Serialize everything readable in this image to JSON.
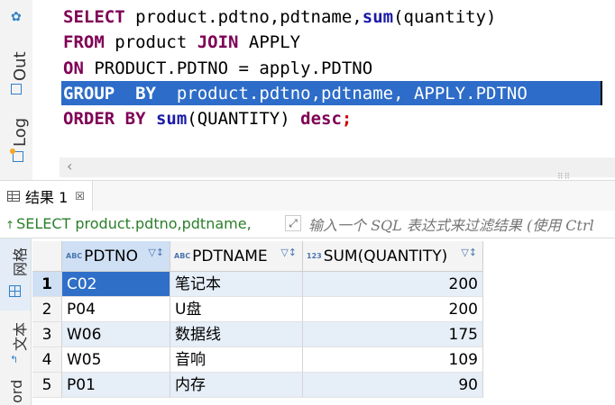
{
  "left_strip": {
    "output_label": "Out",
    "log_label": "Log"
  },
  "editor": {
    "line1": {
      "kw": "SELECT",
      "text1": " product.pdtno,pdtname,",
      "fn": "sum",
      "text2": "(quantity)"
    },
    "line2": {
      "kw1": "FROM",
      "text1": " product ",
      "kw2": "JOIN",
      "text2": " APPLY"
    },
    "line3": {
      "kw": "ON",
      "text": " PRODUCT.PDTNO = apply.PDTNO"
    },
    "line4": {
      "kw1": "GROUP",
      "kw2": "BY",
      "text": "  product.pdtno,pdtname, APPLY.PDTNO "
    },
    "line5": {
      "kw": "ORDER BY",
      "fn": "sum",
      "text": "(QUANTITY) ",
      "kw2": "desc",
      "semi": ";"
    }
  },
  "results": {
    "tab_label": "结果 1",
    "close_symbol": "☒",
    "query_preview": "SELECT product.pdtno,pdtname,",
    "filter_placeholder": "输入一个 SQL 表达式来过滤结果 (使用 Ctrl",
    "side_labels": {
      "grid": "网格",
      "text": "文本",
      "record": "ord"
    },
    "columns": [
      {
        "type": "ABC",
        "name": "PDTNO"
      },
      {
        "type": "ABC",
        "name": "PDTNAME"
      },
      {
        "type": "123",
        "name": "SUM(QUANTITY)"
      }
    ],
    "rows": [
      {
        "idx": "1",
        "pdtno": "C02",
        "pdtname": "笔记本",
        "sum": "200"
      },
      {
        "idx": "2",
        "pdtno": "P04",
        "pdtname": "U盘",
        "sum": "200"
      },
      {
        "idx": "3",
        "pdtno": "W06",
        "pdtname": "数据线",
        "sum": "175"
      },
      {
        "idx": "4",
        "pdtno": "W05",
        "pdtname": "音响",
        "sum": "109"
      },
      {
        "idx": "5",
        "pdtno": "P01",
        "pdtname": "内存",
        "sum": "90"
      }
    ]
  },
  "colors": {
    "keyword": "#7f0055",
    "function": "#1a1aa6",
    "selection": "#2d6cc8",
    "filter_green": "#2a7f2a"
  }
}
